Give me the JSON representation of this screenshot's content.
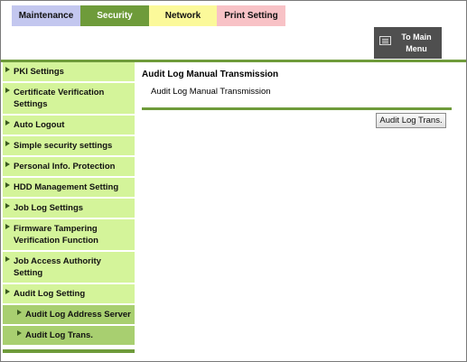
{
  "tabs": [
    {
      "label": "Maintenance"
    },
    {
      "label": "Security"
    },
    {
      "label": "Network"
    },
    {
      "label": "Print Setting"
    }
  ],
  "to_main_menu": {
    "line1": "To Main",
    "line2": "Menu",
    "icon": "menu-list-icon"
  },
  "sidebar": {
    "items": [
      {
        "label": "PKI Settings"
      },
      {
        "label": "Certificate Verification Settings"
      },
      {
        "label": "Auto Logout"
      },
      {
        "label": "Simple security settings"
      },
      {
        "label": "Personal Info. Protection"
      },
      {
        "label": "HDD Management Setting"
      },
      {
        "label": "Job Log Settings"
      },
      {
        "label": "Firmware Tampering Verification Function"
      },
      {
        "label": "Job Access Authority Setting"
      },
      {
        "label": "Audit Log Setting"
      }
    ],
    "subitems": [
      {
        "label": "Audit Log Address Server"
      },
      {
        "label": "Audit Log Trans."
      }
    ]
  },
  "main": {
    "title": "Audit Log Manual Transmission",
    "subtitle": "Audit Log Manual Transmission",
    "button_label": "Audit Log Trans."
  },
  "colors": {
    "accent_green": "#6e9b3a",
    "sidebar_bg": "#d4f49a",
    "sidebar_sub_bg": "#a8cf70",
    "tab_maintenance": "#c3c7ef",
    "tab_network": "#fbf99a",
    "tab_print": "#f8c2c6"
  }
}
